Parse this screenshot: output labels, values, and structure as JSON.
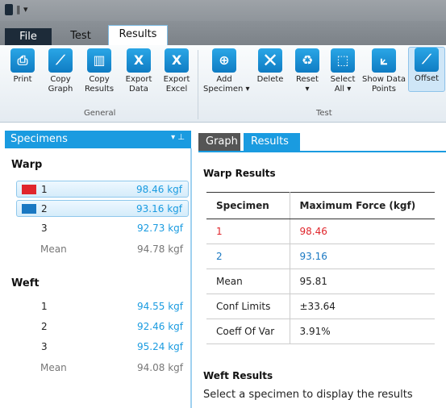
{
  "tabs": {
    "file": "File",
    "test": "Test",
    "results": "Results"
  },
  "ribbon": {
    "general_buttons": [
      {
        "label": "Print",
        "icon": "printer-icon"
      },
      {
        "label": "Copy\nGraph",
        "icon": "copy-graph-icon"
      },
      {
        "label": "Copy\nResults",
        "icon": "copy-results-icon"
      },
      {
        "label": "Export\nData",
        "icon": "excel-icon"
      },
      {
        "label": "Export\nExcel",
        "icon": "excel-icon"
      }
    ],
    "general_label": "General",
    "test_buttons": [
      {
        "label": "Add\nSpecimen ▾",
        "icon": "add-specimen-icon"
      },
      {
        "label": "Delete",
        "icon": "delete-icon"
      },
      {
        "label": "Reset\n▾",
        "icon": "reset-icon"
      },
      {
        "label": "Select\nAll ▾",
        "icon": "select-all-icon"
      },
      {
        "label": "Show Data\nPoints",
        "icon": "data-points-icon"
      },
      {
        "label": "Offset",
        "icon": "offset-icon"
      }
    ],
    "test_label": "Test"
  },
  "specimens": {
    "title": "Specimens",
    "warp_label": "Warp",
    "warp": [
      {
        "num": "1",
        "value": "98.46 kgf",
        "color": "#e0252b"
      },
      {
        "num": "2",
        "value": "93.16 kgf",
        "color": "#1a78c2"
      },
      {
        "num": "3",
        "value": "92.73 kgf"
      }
    ],
    "warp_mean": {
      "label": "Mean",
      "value": "94.78 kgf"
    },
    "weft_label": "Weft",
    "weft": [
      {
        "num": "1",
        "value": "94.55 kgf"
      },
      {
        "num": "2",
        "value": "92.46 kgf"
      },
      {
        "num": "3",
        "value": "95.24 kgf"
      }
    ],
    "weft_mean": {
      "label": "Mean",
      "value": "94.08 kgf"
    }
  },
  "results_pane": {
    "tab_graph": "Graph",
    "tab_results": "Results",
    "warp_title": "Warp Results",
    "col1": "Specimen",
    "col2": "Maximum Force (kgf)",
    "rows": [
      {
        "a": "1",
        "b": "98.46"
      },
      {
        "a": "2",
        "b": "93.16"
      },
      {
        "a": "Mean",
        "b": "95.81"
      },
      {
        "a": "Conf Limits",
        "b": "±33.64"
      },
      {
        "a": "Coeff Of Var",
        "b": "3.91%"
      }
    ],
    "weft_title": "Weft Results",
    "weft_note": "Select a specimen to display the results"
  }
}
